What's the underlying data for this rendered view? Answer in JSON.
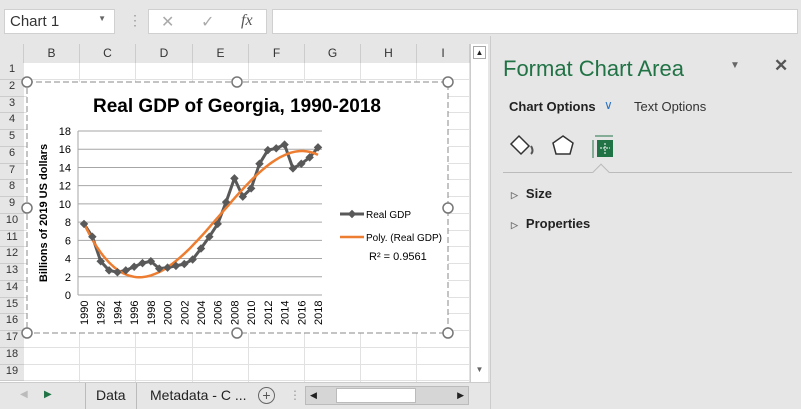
{
  "name_box": {
    "value": "Chart 1"
  },
  "formula_bar": {
    "cancel_icon": "✕",
    "enter_icon": "✓",
    "fx_label": "fx",
    "value": ""
  },
  "columns": [
    "B",
    "C",
    "D",
    "E",
    "F",
    "G",
    "H",
    "I"
  ],
  "rows": [
    "1",
    "2",
    "3",
    "4",
    "5",
    "6",
    "7",
    "8",
    "9",
    "10",
    "11",
    "12",
    "13",
    "14",
    "15",
    "16",
    "17",
    "18",
    "19"
  ],
  "panel": {
    "title": "Format Chart Area",
    "tab_chart_options": "Chart Options",
    "tab_text_options": "Text Options",
    "sections": [
      "Size",
      "Properties"
    ],
    "icons": [
      "fill-line-icon",
      "effects-icon",
      "size-properties-icon"
    ],
    "accent": "#217346"
  },
  "sheet_tabs": {
    "tabs": [
      "Data",
      "Metadata - C ..."
    ]
  },
  "chart_data": {
    "type": "line",
    "title": "Real GDP of Georgia, 1990-2018",
    "ylabel": "Billions of 2019 US dollars",
    "xlabel": "",
    "ylim": [
      0,
      18
    ],
    "yticks": [
      0,
      2,
      4,
      6,
      8,
      10,
      12,
      14,
      16,
      18
    ],
    "xticks": [
      "1990",
      "1992",
      "1994",
      "1996",
      "1998",
      "2000",
      "2002",
      "2004",
      "2006",
      "2008",
      "2010",
      "2012",
      "2014",
      "2016",
      "2018"
    ],
    "grid": true,
    "legend_position": "right",
    "x": [
      1990,
      1991,
      1992,
      1993,
      1994,
      1995,
      1996,
      1997,
      1998,
      1999,
      2000,
      2001,
      2002,
      2003,
      2004,
      2005,
      2006,
      2007,
      2008,
      2009,
      2010,
      2011,
      2012,
      2013,
      2014,
      2015,
      2016,
      2017,
      2018
    ],
    "series": [
      {
        "name": "Real GDP",
        "color": "#595959",
        "values": [
          7.8,
          6.4,
          3.7,
          2.7,
          2.5,
          2.7,
          3.1,
          3.5,
          3.7,
          2.9,
          3.0,
          3.2,
          3.4,
          3.9,
          5.1,
          6.4,
          7.8,
          10.2,
          12.8,
          10.8,
          11.7,
          14.4,
          15.9,
          16.1,
          16.5,
          13.9,
          14.4,
          15.1,
          16.2
        ]
      }
    ],
    "trendline": {
      "name": "Poly. (Real GDP)",
      "type": "polynomial",
      "color": "#ed7d31",
      "r_squared_label": "R² = 0.9561"
    }
  }
}
